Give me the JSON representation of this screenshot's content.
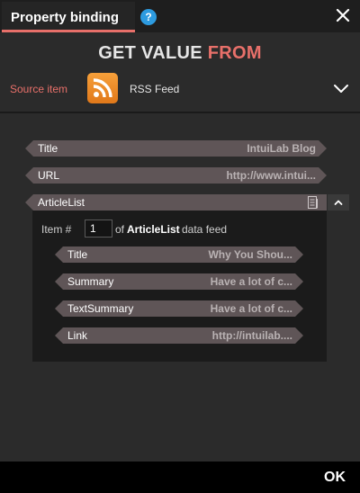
{
  "dialog": {
    "title": "Property binding",
    "help_glyph": "?",
    "close_icon": "close-icon"
  },
  "header": {
    "heading_part1": "GET VALUE",
    "heading_part2": "FROM",
    "source_label": "Source item",
    "source_icon": "rss-icon",
    "source_name": "RSS Feed"
  },
  "properties": [
    {
      "label": "Title",
      "value": "IntuiLab Blog"
    },
    {
      "label": "URL",
      "value": "http://www.intui..."
    }
  ],
  "article_list": {
    "label": "ArticleList",
    "item_prefix": "Item #",
    "item_number": "1",
    "item_of": "of",
    "feed_name": "ArticleList",
    "item_suffix": "data feed",
    "fields": [
      {
        "label": "Title",
        "value": "Why You Shou..."
      },
      {
        "label": "Summary",
        "value": "Have a lot of c..."
      },
      {
        "label": "TextSummary",
        "value": "Have a lot of c..."
      },
      {
        "label": "Link",
        "value": "http://intuilab...."
      }
    ]
  },
  "footer": {
    "ok_label": "OK"
  },
  "colors": {
    "accent": "#e8706a",
    "pill": "#5f5557",
    "help": "#2d9be0",
    "rss": "#f08a2a"
  }
}
